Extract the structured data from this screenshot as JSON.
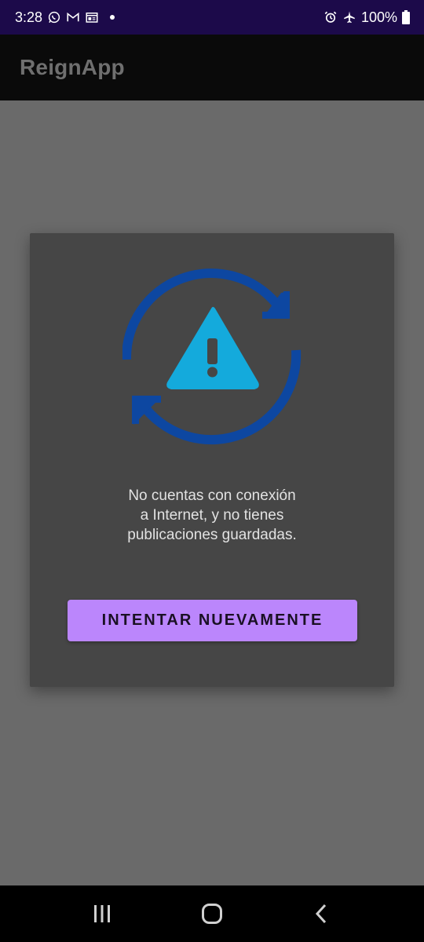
{
  "status_bar": {
    "time": "3:28",
    "battery": "100%",
    "left_icons": [
      "whatsapp-icon",
      "gmail-icon",
      "calendar-icon"
    ],
    "right_icons": [
      "alarm-icon",
      "airplane-mode-icon",
      "battery-icon"
    ]
  },
  "app_bar": {
    "title": "ReignApp"
  },
  "dialog": {
    "icon": "sync-warning-icon",
    "message": "No cuentas con conexión\na Internet, y no tienes\npublicaciones guardadas.",
    "button_label": "INTENTAR NUEVAMENTE"
  },
  "nav_bar": {
    "buttons": [
      "recents-icon",
      "home-icon",
      "back-icon"
    ]
  },
  "colors": {
    "status_bar_bg": "#1c0a4a",
    "app_bar_bg": "#0a0a0a",
    "scrim": "#6a6a6a",
    "dialog_bg": "#464646",
    "button_bg": "#bb86fc",
    "arrow_blue": "#0d47a1",
    "warning_triangle": "#14aadc"
  }
}
